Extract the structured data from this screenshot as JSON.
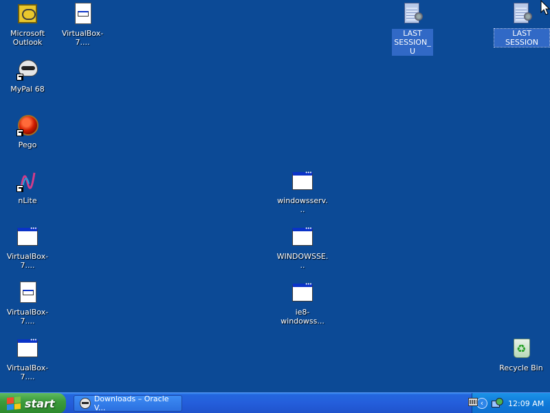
{
  "desktop": {
    "icons": [
      {
        "label": "Microsoft Outlook",
        "icon": "outlook-icon"
      },
      {
        "label": "VirtualBox-7....",
        "icon": "installer-icon"
      },
      {
        "label": "MyPal 68",
        "icon": "mypal-icon"
      },
      {
        "label": "Pego",
        "icon": "pego-icon"
      },
      {
        "label": "nLite",
        "icon": "nlite-icon"
      },
      {
        "label": "VirtualBox-7....",
        "icon": "window-icon"
      },
      {
        "label": "VirtualBox-7....",
        "icon": "installer-icon"
      },
      {
        "label": "VirtualBox-7....",
        "icon": "window-icon"
      },
      {
        "label": "windowsserv...",
        "icon": "window-icon"
      },
      {
        "label": "WINDOWSSE...",
        "icon": "window-icon"
      },
      {
        "label": "ie8-windowss...",
        "icon": "window-icon"
      },
      {
        "label": "LAST SESSION_U",
        "icon": "notepad-icon"
      },
      {
        "label": "LAST SESSION",
        "icon": "notepad-icon"
      },
      {
        "label": "Recycle Bin",
        "icon": "recycle-bin-icon"
      }
    ]
  },
  "taskbar": {
    "start_label": "start",
    "window_button_label": "Downloads – Oracle V...",
    "clock": "12:09 AM"
  },
  "colors": {
    "desktop_background": "#0c4a96",
    "taskbar": "#245edb",
    "start_button": "#3c9c3c",
    "selection": "#3169c6"
  }
}
